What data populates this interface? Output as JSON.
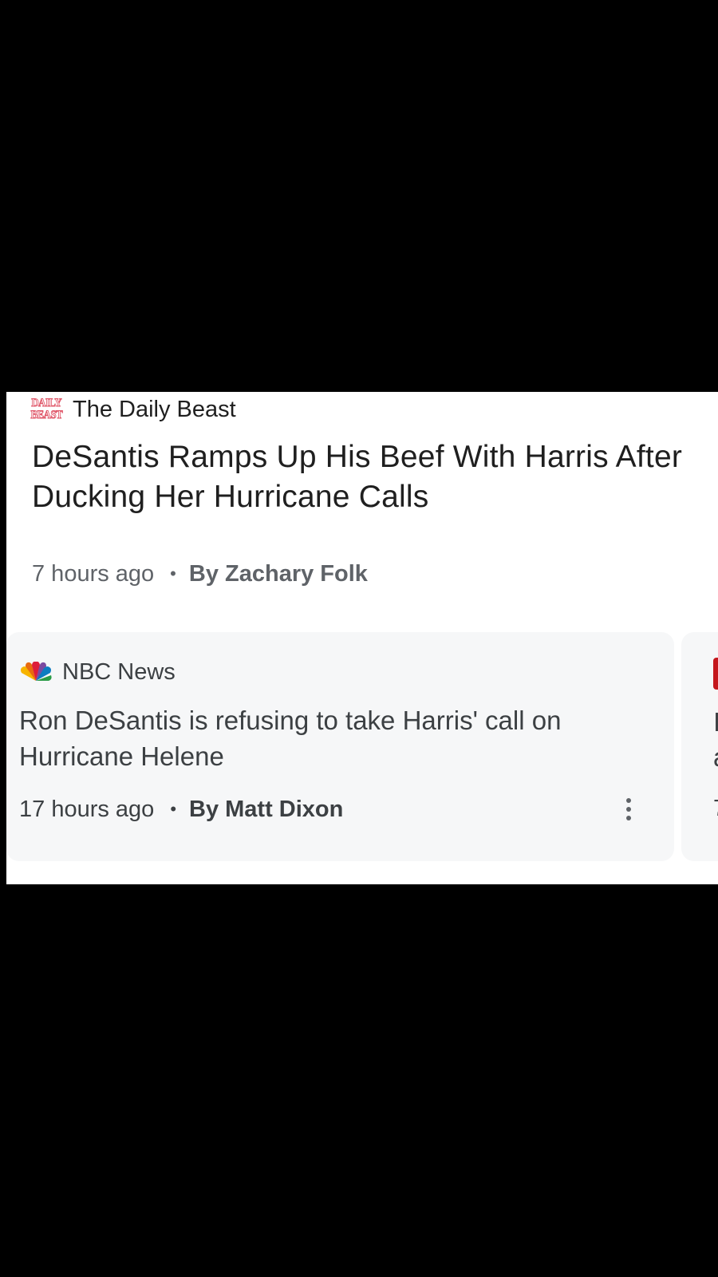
{
  "top_story": {
    "source_logo_lines": [
      "DAILY",
      "BEAST"
    ],
    "source": "The Daily Beast",
    "headline": "DeSantis Ramps Up His Beef With Harris After Ducking Her Hurricane Calls",
    "time": "7 hours ago",
    "separator": "•",
    "author": "By Zachary Folk"
  },
  "cards": [
    {
      "source": "NBC News",
      "source_icon": "nbc-peacock-icon",
      "headline": "Ron DeSantis is refusing to take Harris' call on Hurricane Helene",
      "time": "17 hours ago",
      "separator": "•",
      "author": "By Matt Dixon",
      "menu_icon": "more-vert-icon"
    },
    {
      "source_icon": "red-publisher-logo-icon",
      "headline_line1_fragment": "I",
      "headline_line2_fragment": "a",
      "time_fragment": "7"
    }
  ],
  "colors": {
    "background": "#000000",
    "panel": "#ffffff",
    "card": "#f6f7f8",
    "headline": "#1f1f1f",
    "meta": "#5f6368",
    "daily_beast_red": "#e0586a"
  }
}
